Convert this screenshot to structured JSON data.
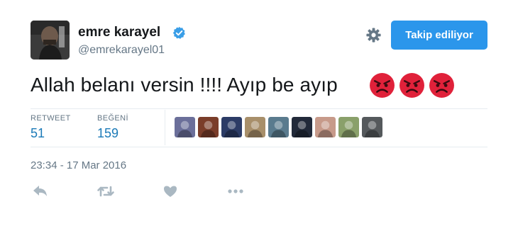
{
  "user": {
    "display_name": "emre karayel",
    "handle": "@emrekarayel01",
    "verified": true
  },
  "follow_button": {
    "label": "Takip ediliyor"
  },
  "tweet": {
    "text": "Allah belanı versin !!!! Ayıp be ayıp",
    "emojis": [
      "angry-face",
      "angry-face",
      "angry-face"
    ],
    "timestamp": "23:34 - 17 Mar 2016"
  },
  "stats": {
    "retweets": {
      "label": "RETWEET",
      "value": "51"
    },
    "likes": {
      "label": "BEĞENİ",
      "value": "159"
    }
  },
  "likers": [
    {
      "color": "#6b6f9a"
    },
    {
      "color": "#7a3d2a"
    },
    {
      "color": "#2c3c66"
    },
    {
      "color": "#a88f6a"
    },
    {
      "color": "#5a7b8e"
    },
    {
      "color": "#222a3a"
    },
    {
      "color": "#c79a8a"
    },
    {
      "color": "#8aa06a"
    },
    {
      "color": "#55595c"
    }
  ],
  "colors": {
    "accent": "#1b7ab8",
    "button": "#2b96eb",
    "muted": "#657786",
    "emoji_red": "#e0213a"
  },
  "actions": [
    "reply-icon",
    "retweet-icon",
    "like-icon",
    "more-icon"
  ]
}
